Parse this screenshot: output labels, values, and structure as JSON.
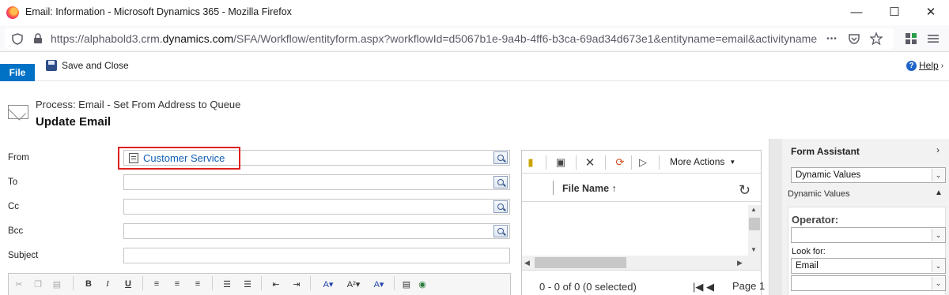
{
  "browser": {
    "title": "Email: Information - Microsoft Dynamics 365 - Mozilla Firefox",
    "url_prefix": "https://alphabold3.crm.",
    "url_domain": "dynamics.com",
    "url_suffix": "/SFA/Workflow/entityform.aspx?workflowId=d5067b1e-9a4b-4ff6-b3ca-69ad34d673e1&entityname=email&activityname",
    "more_glyph": "•••"
  },
  "ribbon": {
    "file_label": "File",
    "save_close_label": "Save and Close",
    "help_label": "Help"
  },
  "header": {
    "process": "Process: Email - Set From Address to Queue",
    "title": "Update Email"
  },
  "form": {
    "from_label": "From",
    "from_value": "Customer Service",
    "to_label": "To",
    "cc_label": "Cc",
    "bcc_label": "Bcc",
    "subject_label": "Subject"
  },
  "editor_toolbar": {
    "bold": "B",
    "italic": "I",
    "underline": "U"
  },
  "attachments": {
    "more_actions": "More Actions",
    "column_file_name": "File Name ↑",
    "status": "0 - 0 of 0 (0 selected)",
    "page_label": "Page 1"
  },
  "form_assistant": {
    "title": "Form Assistant",
    "type_selected": "Dynamic Values",
    "section_label": "Dynamic Values",
    "operator_label": "Operator:",
    "operator_value": "",
    "look_for_label": "Look for:",
    "look_for_value": "Email",
    "look_for_attr_value": ""
  },
  "colors": {
    "accent": "#0072c6",
    "highlight_border": "#e02020",
    "link": "#1160b7"
  },
  "icons": [
    "firefox-logo",
    "minimize-icon",
    "maximize-icon",
    "close-icon",
    "shield-icon",
    "lock-icon",
    "pocket-icon",
    "star-icon",
    "extensions-icon",
    "menu-icon",
    "save-icon",
    "help-icon",
    "envelope-icon",
    "lookup-icon",
    "record-icon",
    "refresh-icon"
  ]
}
